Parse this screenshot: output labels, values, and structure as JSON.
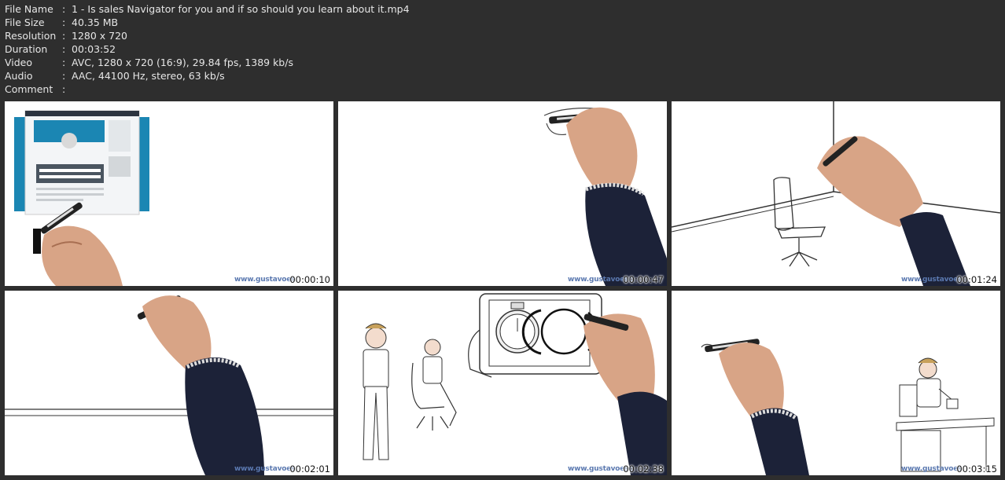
{
  "info": {
    "rows": [
      {
        "key": "File Name",
        "sep": ":",
        "value": "1 - Is sales Navigator for you and if so should you learn about it.mp4"
      },
      {
        "key": "File Size",
        "sep": ":",
        "value": "40.35 MB"
      },
      {
        "key": "Resolution",
        "sep": ":",
        "value": "1280 x 720"
      },
      {
        "key": "Duration",
        "sep": ":",
        "value": "00:03:52"
      },
      {
        "key": "Video",
        "sep": ":",
        "value": "AVC, 1280 x 720 (16:9), 29.84 fps, 1389 kb/s"
      },
      {
        "key": "Audio",
        "sep": ":",
        "value": "AAC, 44100 Hz, stereo, 63 kb/s"
      },
      {
        "key": "Comment",
        "sep": ":",
        "value": ""
      }
    ]
  },
  "thumbnails": [
    {
      "timestamp": "00:00:10",
      "watermark": "www.gustavoes"
    },
    {
      "timestamp": "00:00:47",
      "watermark": "www.gustavoesc"
    },
    {
      "timestamp": "00:01:24",
      "watermark": "www.gustavoes"
    },
    {
      "timestamp": "00:02:01",
      "watermark": "www.gustavoes"
    },
    {
      "timestamp": "00:02:38",
      "watermark": "www.gustavoesc"
    },
    {
      "timestamp": "00:03:15",
      "watermark": "www.gustavoes"
    }
  ],
  "colors": {
    "background": "#2e2e2e",
    "text": "#e6e6e6",
    "sleeve": "#1c2238",
    "watermark": "#5b79b0"
  }
}
